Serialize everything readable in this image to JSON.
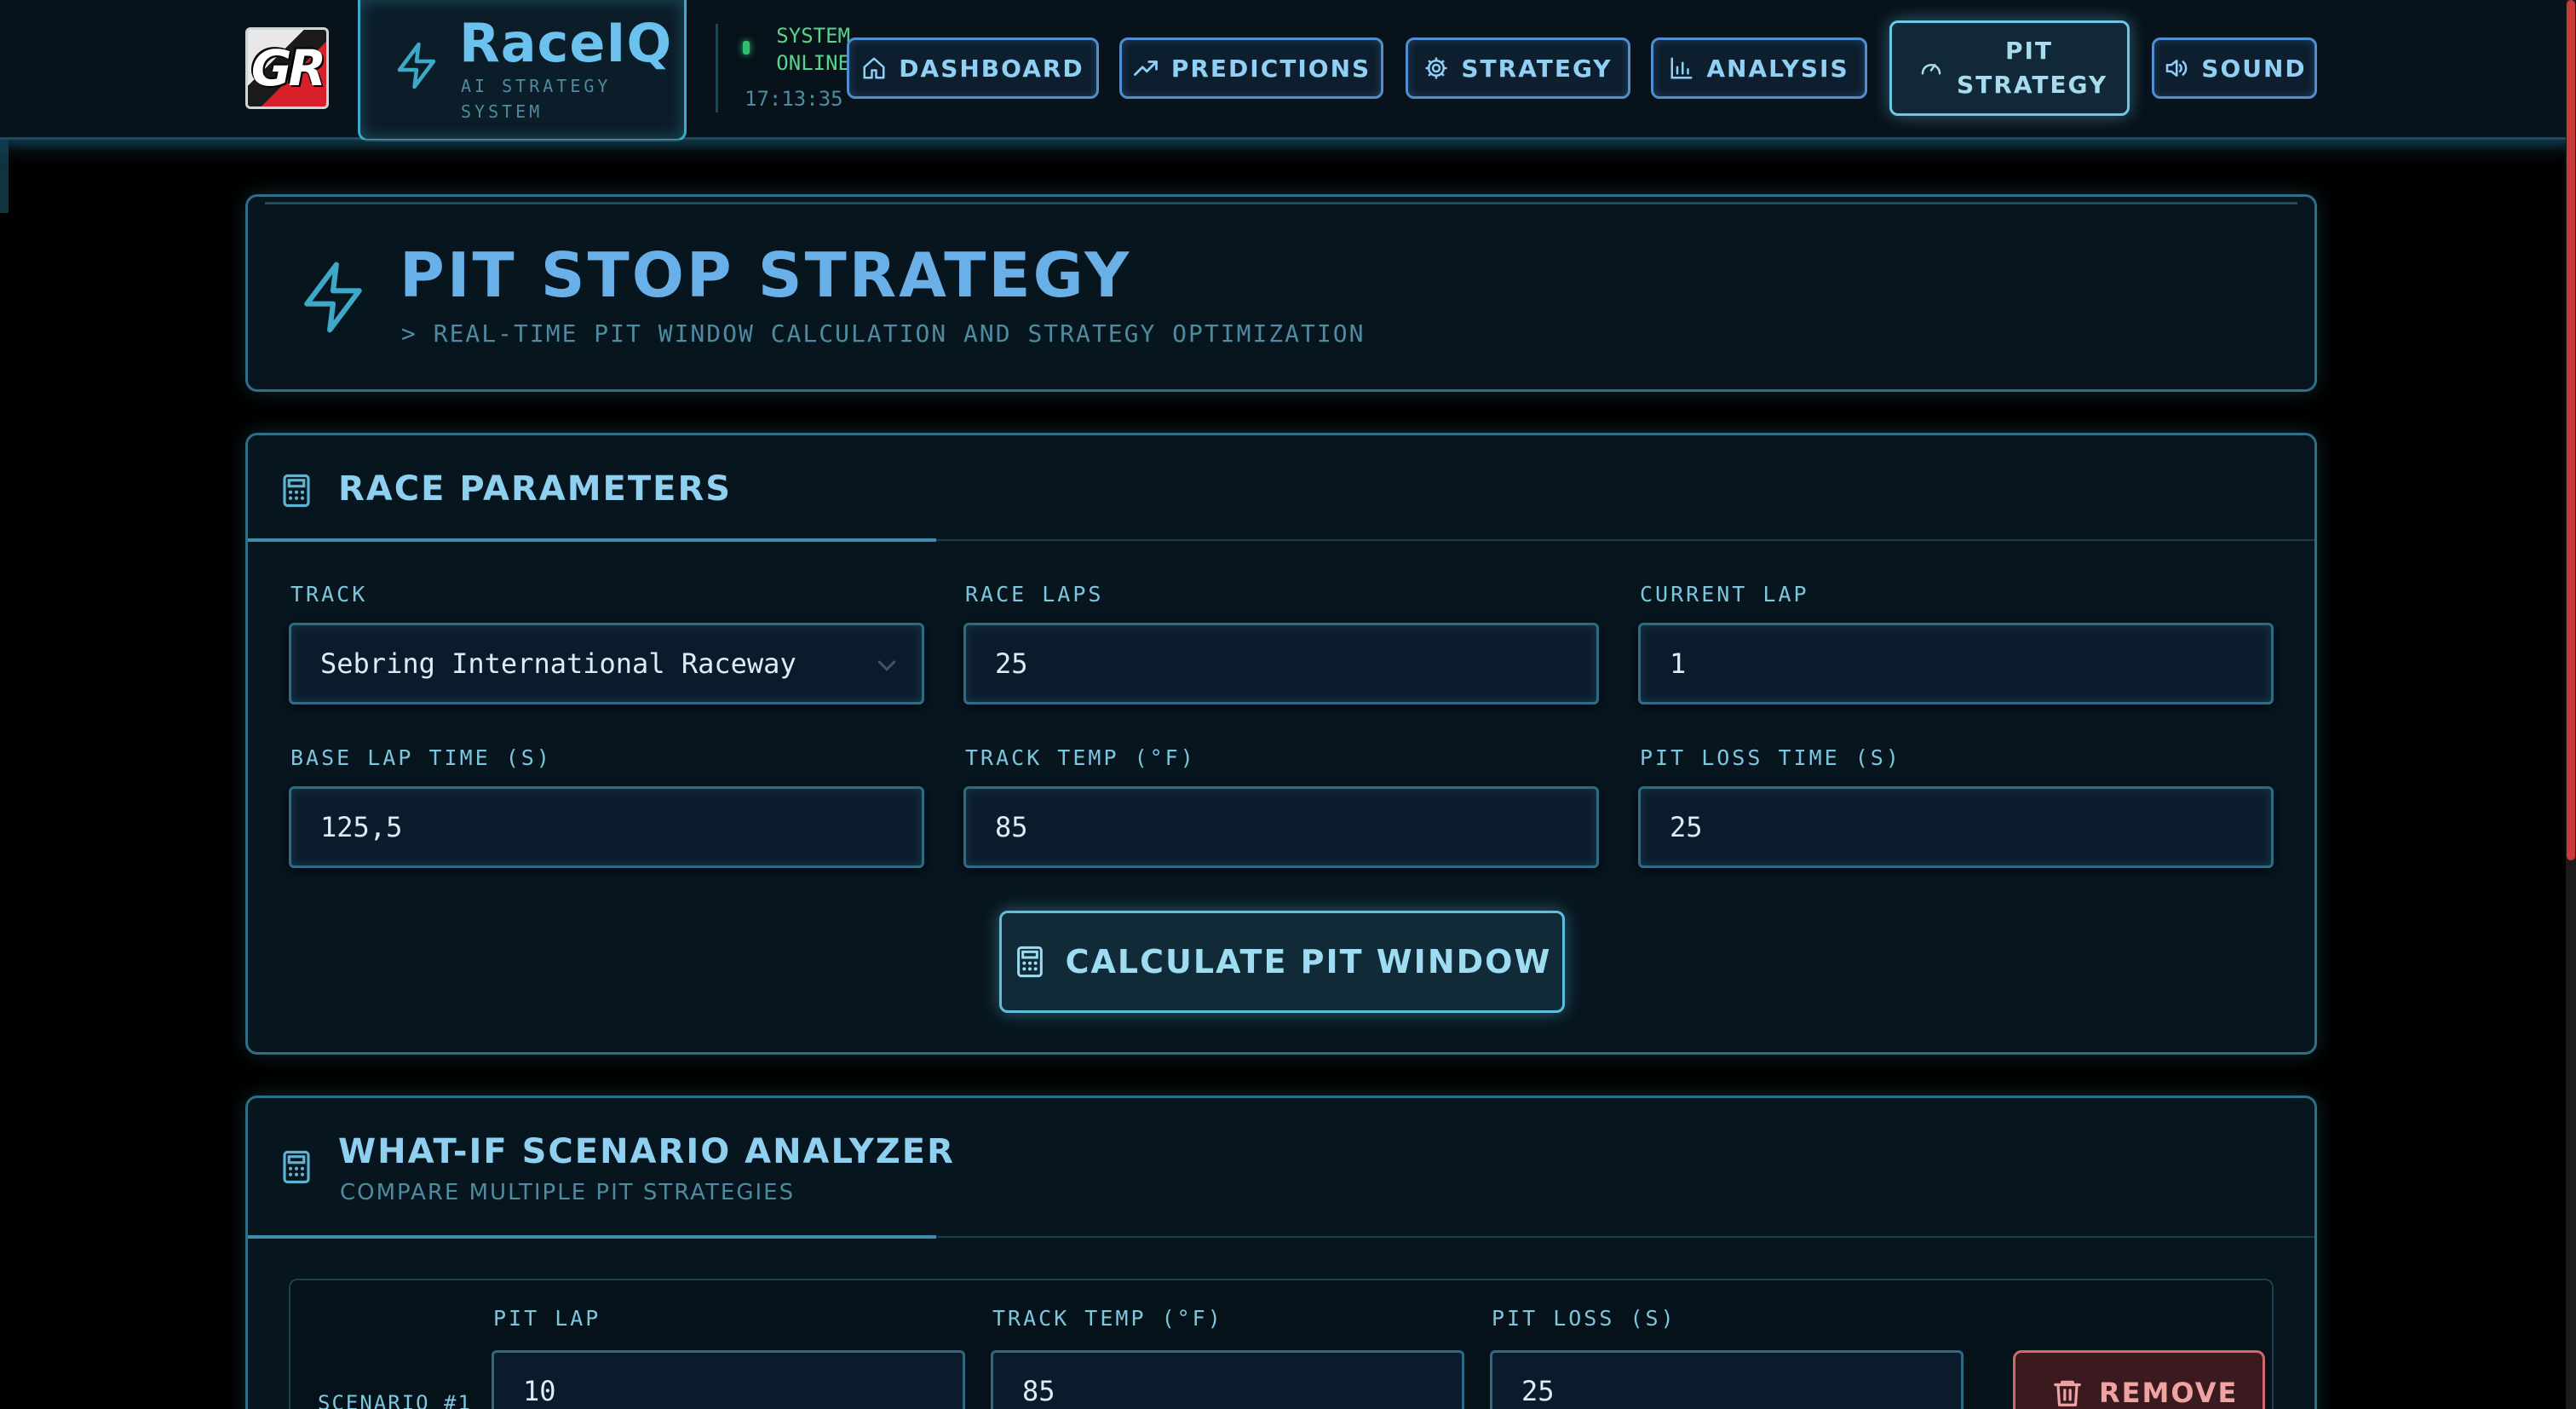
{
  "header": {
    "logo_text": "GR",
    "brand_name": "RaceIQ",
    "brand_sub": "AI STRATEGY SYSTEM",
    "status_text": "SYSTEM ONLINE",
    "time": "17:13:35",
    "nav": [
      {
        "label": "DASHBOARD",
        "icon": "home-icon",
        "active": false
      },
      {
        "label": "PREDICTIONS",
        "icon": "trending-up-icon",
        "active": false
      },
      {
        "label": "STRATEGY",
        "icon": "gear-icon",
        "active": false
      },
      {
        "label": "ANALYSIS",
        "icon": "bar-chart-icon",
        "active": false
      },
      {
        "label": "PIT STRATEGY",
        "icon": "gauge-icon",
        "active": true
      },
      {
        "label": "SOUND",
        "icon": "speaker-icon",
        "active": false
      }
    ]
  },
  "hero": {
    "title": "PIT STOP STRATEGY",
    "subtitle": "> REAL-TIME PIT WINDOW CALCULATION AND STRATEGY OPTIMIZATION"
  },
  "race_parameters": {
    "title": "RACE PARAMETERS",
    "fields": {
      "track": {
        "label": "TRACK",
        "value": "Sebring International Raceway"
      },
      "race_laps": {
        "label": "RACE LAPS",
        "value": "25"
      },
      "current_lap": {
        "label": "CURRENT LAP",
        "value": "1"
      },
      "base_lap_time": {
        "label": "BASE LAP TIME (S)",
        "value": "125,5"
      },
      "track_temp": {
        "label": "TRACK TEMP (°F)",
        "value": "85"
      },
      "pit_loss_time": {
        "label": "PIT LOSS TIME (S)",
        "value": "25"
      }
    },
    "calculate_label": "CALCULATE PIT WINDOW"
  },
  "what_if": {
    "title": "WHAT-IF SCENARIO ANALYZER",
    "subtitle": "COMPARE MULTIPLE PIT STRATEGIES",
    "scenario": {
      "name": "SCENARIO #1",
      "pit_lap_label": "PIT LAP",
      "pit_lap": "10",
      "track_temp_label": "TRACK TEMP (°F)",
      "track_temp": "85",
      "pit_loss_label": "PIT LOSS (S)",
      "pit_loss": "25",
      "remove_label": "REMOVE"
    }
  },
  "colors": {
    "accent": "#6ab0e8",
    "border": "#2e6f86",
    "online": "#2fbf6f",
    "danger": "#d06a6a"
  }
}
